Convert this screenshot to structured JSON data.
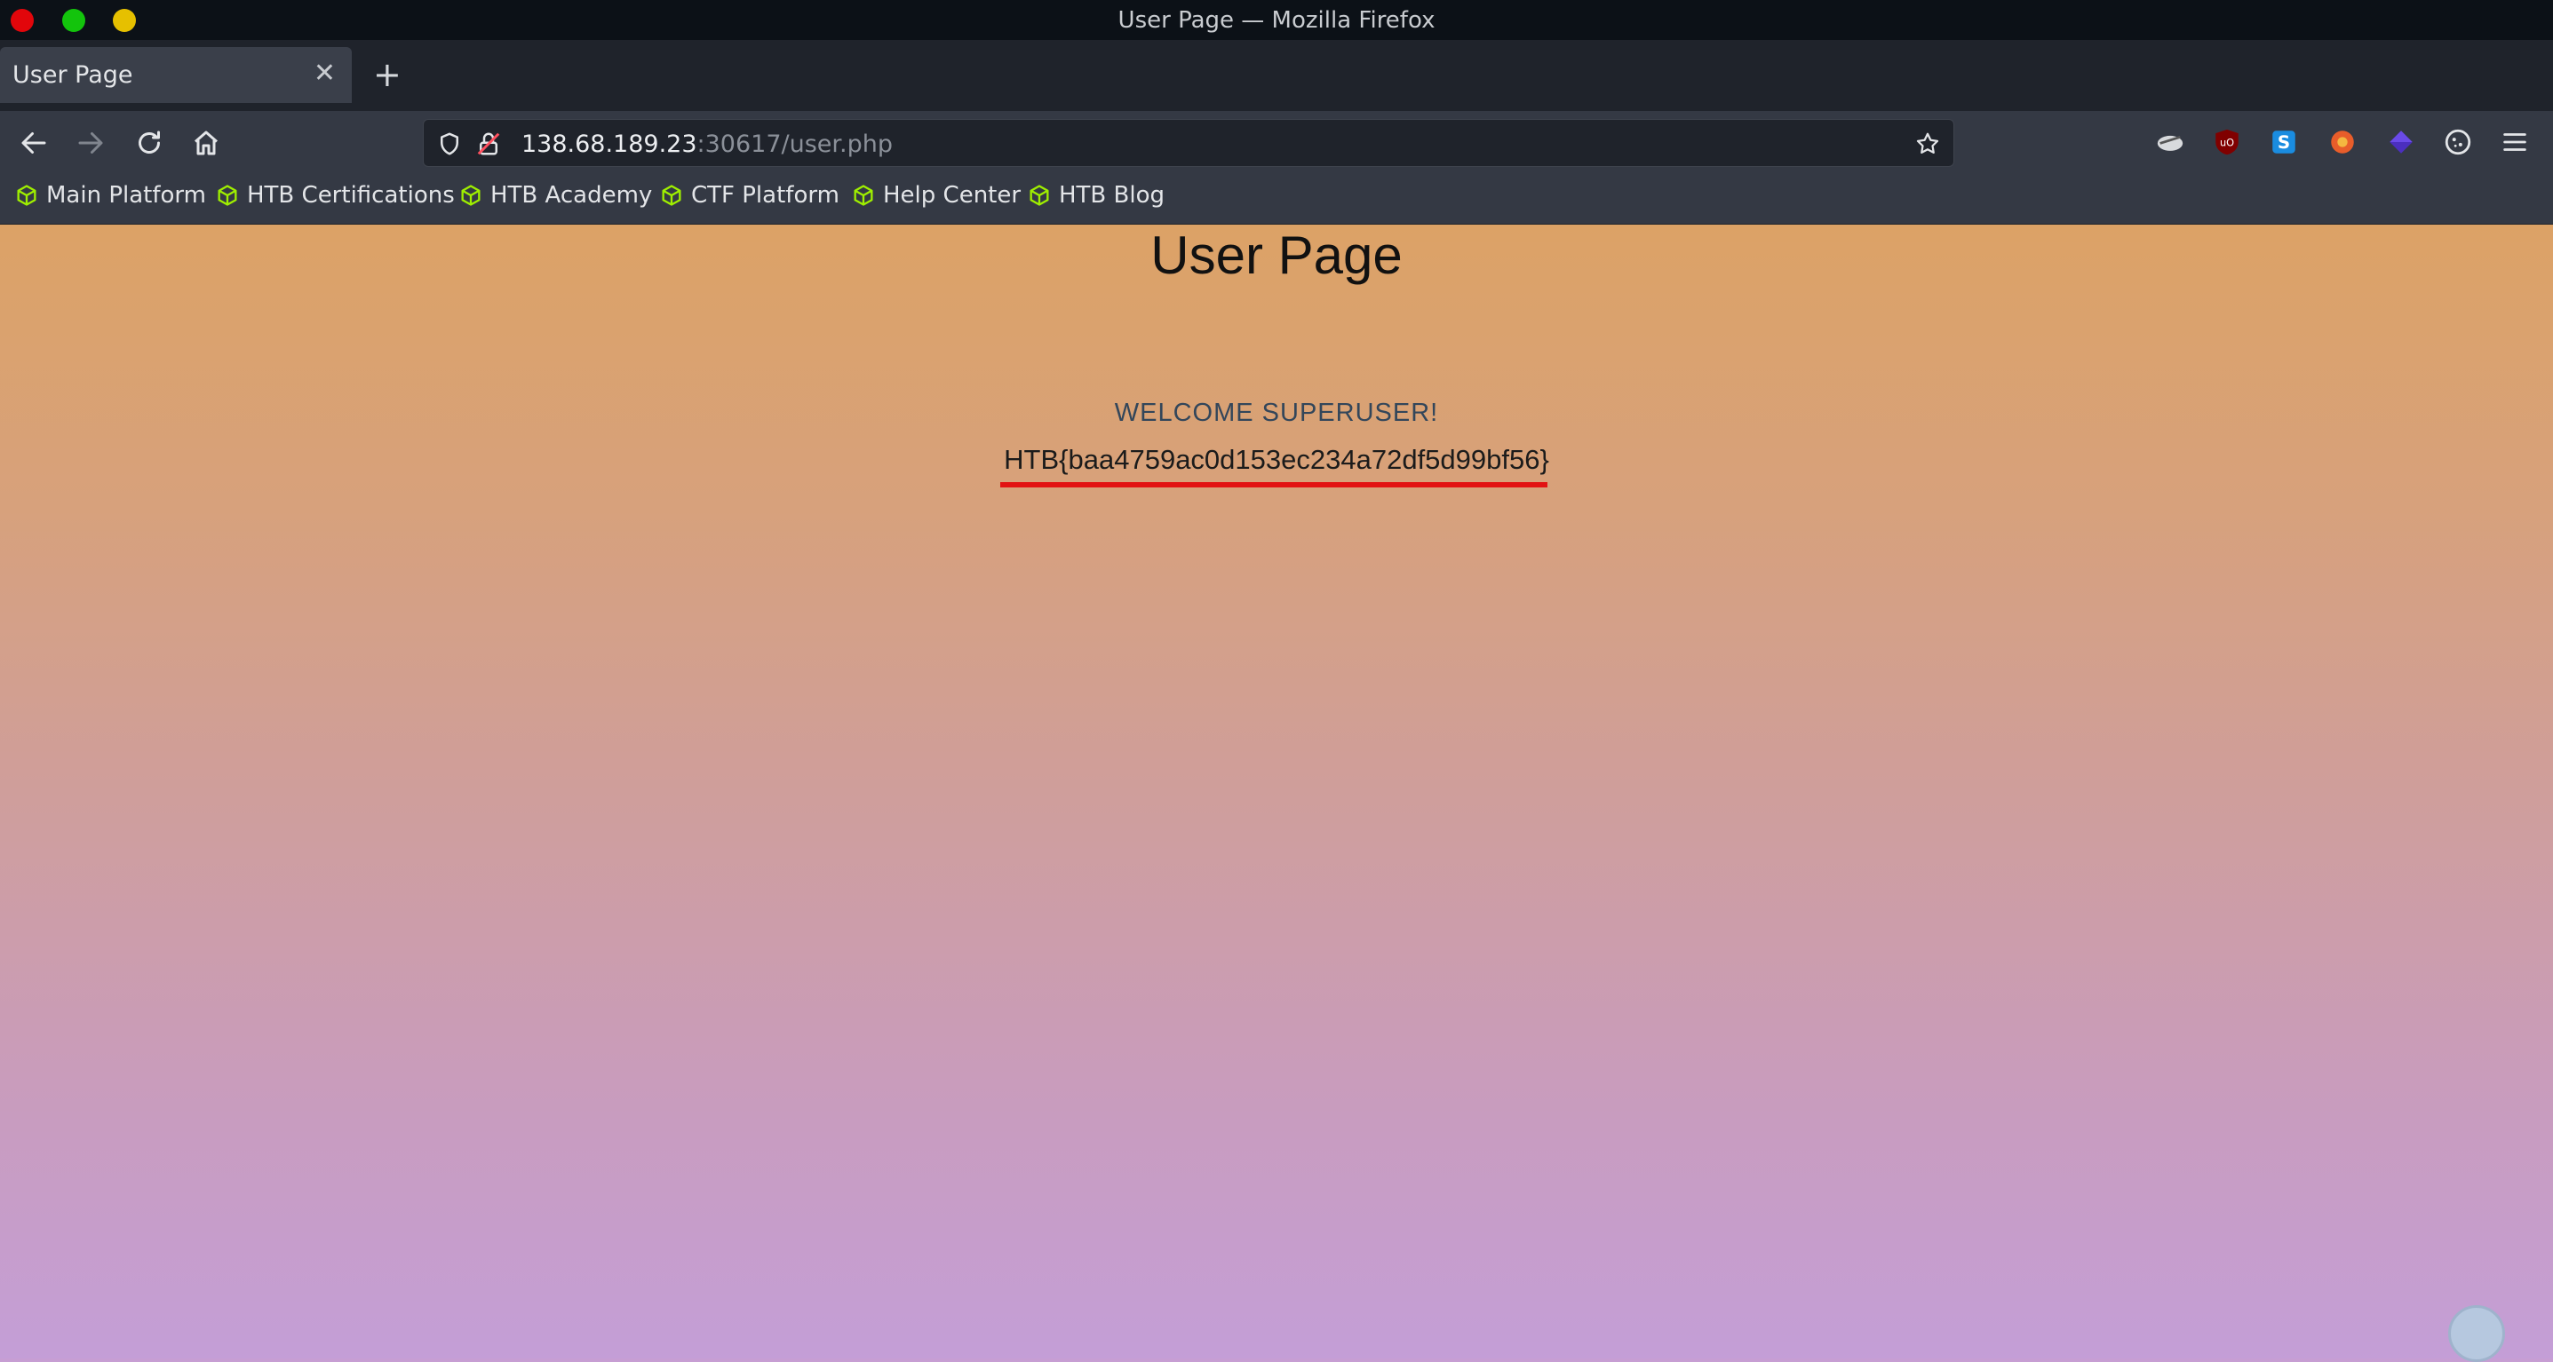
{
  "window": {
    "title": "User Page — Mozilla Firefox"
  },
  "tabs": [
    {
      "label": "User Page"
    }
  ],
  "urlbar": {
    "host": "138.68.189.23",
    "rest": ":30617/user.php"
  },
  "bookmarks": [
    {
      "label": "Main Platform"
    },
    {
      "label": "HTB Certifications"
    },
    {
      "label": "HTB Academy"
    },
    {
      "label": "CTF Platform"
    },
    {
      "label": "Help Center"
    },
    {
      "label": "HTB Blog"
    }
  ],
  "page": {
    "heading": "User Page",
    "welcome": "WELCOME SUPERUSER!",
    "flag": "HTB{baa4759ac0d153ec234a72df5d99bf56}"
  },
  "colors": {
    "highlight_underline": "#e21212",
    "bookmark_icon": "#9fef00"
  },
  "icons": {
    "nav": [
      "back-arrow-icon",
      "forward-arrow-icon",
      "reload-icon",
      "home-icon"
    ],
    "urlbar": [
      "tracking-shield-icon",
      "insecure-lock-icon",
      "bookmark-star-icon"
    ],
    "extensions": [
      "burp-proxy-icon",
      "ublock-icon",
      "stylus-icon",
      "wappalyzer-icon",
      "extension-cube-icon",
      "cookie-editor-icon",
      "app-menu-icon"
    ]
  }
}
